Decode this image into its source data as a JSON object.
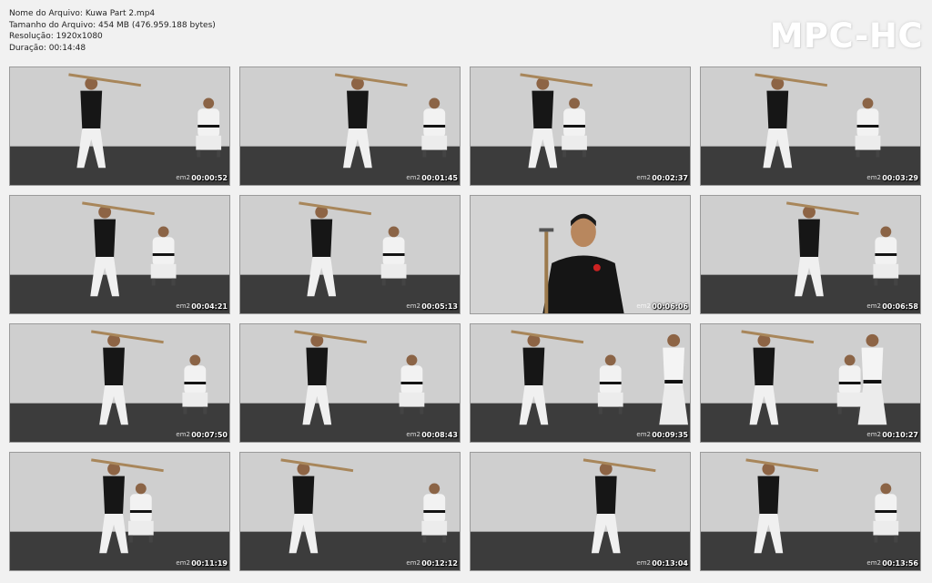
{
  "file_info": {
    "name": "Nome do Arquivo: Kuwa Part 2.mp4",
    "size": "Tamanho do Arquivo: 454 MB (476.959.188 bytes)",
    "resolution": "Resolução: 1920x1080",
    "duration": "Duração: 00:14:48"
  },
  "logo": "MPC-HC",
  "watermark": "em2",
  "thumbnails": [
    {
      "time": "00:00:52"
    },
    {
      "time": "00:01:45"
    },
    {
      "time": "00:02:37"
    },
    {
      "time": "00:03:29"
    },
    {
      "time": "00:04:21"
    },
    {
      "time": "00:05:13"
    },
    {
      "time": "00:06:06"
    },
    {
      "time": "00:06:58"
    },
    {
      "time": "00:07:50"
    },
    {
      "time": "00:08:43"
    },
    {
      "time": "00:09:35"
    },
    {
      "time": "00:10:27"
    },
    {
      "time": "00:11:19"
    },
    {
      "time": "00:12:12"
    },
    {
      "time": "00:13:04"
    },
    {
      "time": "00:13:56"
    }
  ]
}
